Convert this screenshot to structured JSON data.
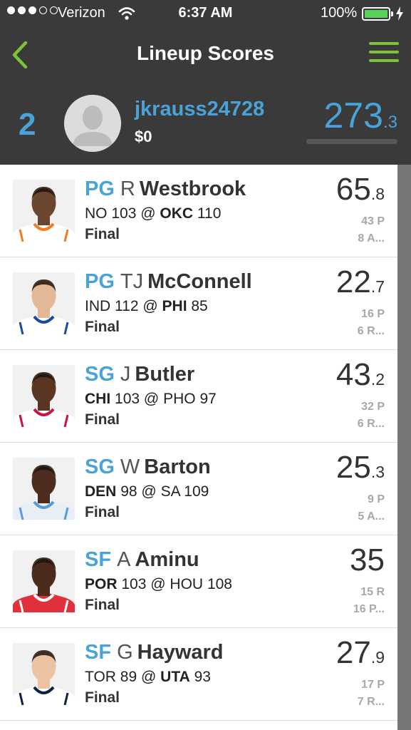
{
  "status_bar": {
    "carrier": "Verizon",
    "time": "6:37 AM",
    "battery_percent": "100%",
    "signal_bars_filled": 3,
    "signal_bars_total": 5,
    "battery_level": 1.0,
    "battery_color": "#58d25a"
  },
  "nav": {
    "title": "Lineup Scores",
    "back_icon": "chevron-left-icon",
    "menu_icon": "hamburger-menu-icon",
    "accent_color": "#7dc338"
  },
  "user": {
    "rank": "2",
    "username": "jkrauss24728",
    "winnings": "$0",
    "score_int": "273",
    "score_dec": ".3",
    "progress": 0.0,
    "accent_color": "#4aa3d8"
  },
  "players": [
    {
      "pos": "PG",
      "initial": "R",
      "last": "Westbrook",
      "away_team": "NO",
      "away_score": "103",
      "home_team": "OKC",
      "home_score": "110",
      "winner": "home",
      "status": "Final",
      "fp_int": "65",
      "fp_dec": ".8",
      "stat1": "43 P",
      "stat2": "8 A...",
      "skin": "#6b4630",
      "jersey": "#ffffff",
      "trim": "#f47b20"
    },
    {
      "pos": "PG",
      "initial": "TJ",
      "last": "McConnell",
      "away_team": "IND",
      "away_score": "112",
      "home_team": "PHI",
      "home_score": "85",
      "winner": "home",
      "status": "Final",
      "fp_int": "22",
      "fp_dec": ".7",
      "stat1": "16 P",
      "stat2": "6 R...",
      "skin": "#e3b896",
      "jersey": "#ffffff",
      "trim": "#1d4a9e"
    },
    {
      "pos": "SG",
      "initial": "J",
      "last": "Butler",
      "away_team": "CHI",
      "away_score": "103",
      "home_team": "PHO",
      "home_score": "97",
      "winner": "away",
      "status": "Final",
      "fp_int": "43",
      "fp_dec": ".2",
      "stat1": "32 P",
      "stat2": "6 R...",
      "skin": "#5a3522",
      "jersey": "#ffffff",
      "trim": "#ce1141"
    },
    {
      "pos": "SG",
      "initial": "W",
      "last": "Barton",
      "away_team": "DEN",
      "away_score": "98",
      "home_team": "SA",
      "home_score": "109",
      "winner": "away",
      "status": "Final",
      "fp_int": "25",
      "fp_dec": ".3",
      "stat1": "9 P",
      "stat2": "5 A...",
      "skin": "#4d2e1e",
      "jersey": "#e8eef6",
      "trim": "#5b9bd5"
    },
    {
      "pos": "SF",
      "initial": "A",
      "last": "Aminu",
      "away_team": "POR",
      "away_score": "103",
      "home_team": "HOU",
      "home_score": "108",
      "winner": "away",
      "status": "Final",
      "fp_int": "35",
      "fp_dec": "",
      "stat1": "15 R",
      "stat2": "16 P...",
      "skin": "#4a2b1c",
      "jersey": "#e0303c",
      "trim": "#ffffff"
    },
    {
      "pos": "SF",
      "initial": "G",
      "last": "Hayward",
      "away_team": "TOR",
      "away_score": "89",
      "home_team": "UTA",
      "home_score": "93",
      "winner": "home",
      "status": "Final",
      "fp_int": "27",
      "fp_dec": ".9",
      "stat1": "17 P",
      "stat2": "7 R...",
      "skin": "#ecc3a2",
      "jersey": "#ffffff",
      "trim": "#0c2340"
    }
  ]
}
